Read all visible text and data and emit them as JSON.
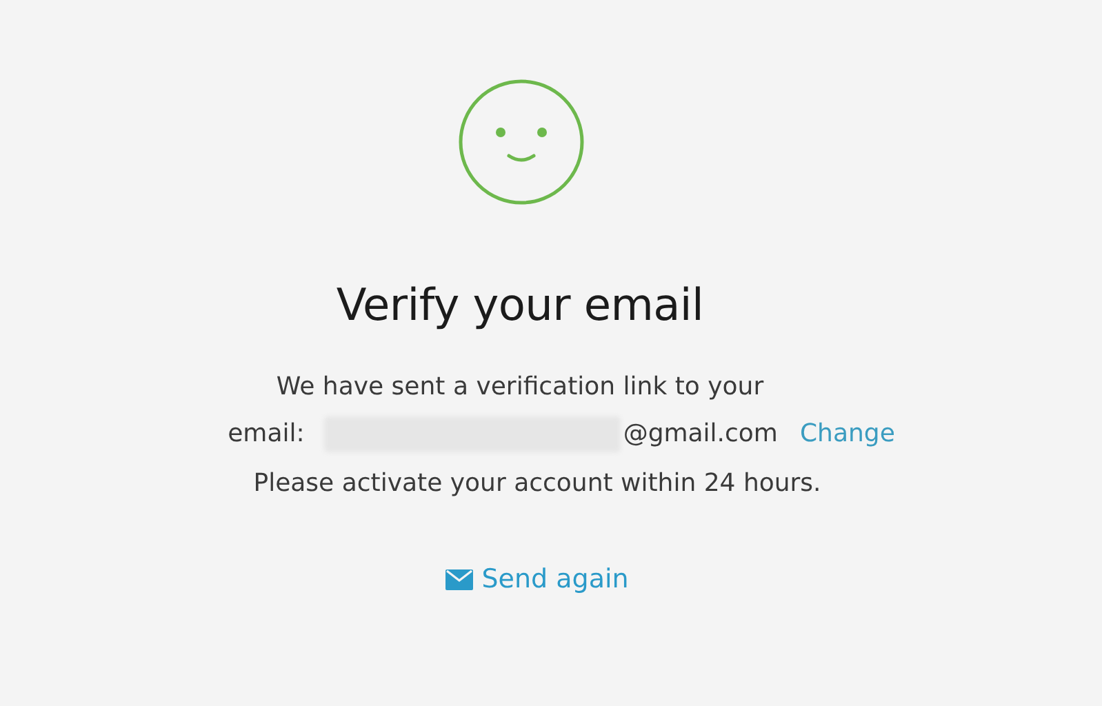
{
  "title": "Verify your email",
  "message": {
    "line_1": "We have sent a verification link to your",
    "email_label": "email:",
    "email_domain": "@gmail.com",
    "change_link": "Change",
    "line_3": "Please activate your account within 24 hours."
  },
  "send_again": "Send again"
}
